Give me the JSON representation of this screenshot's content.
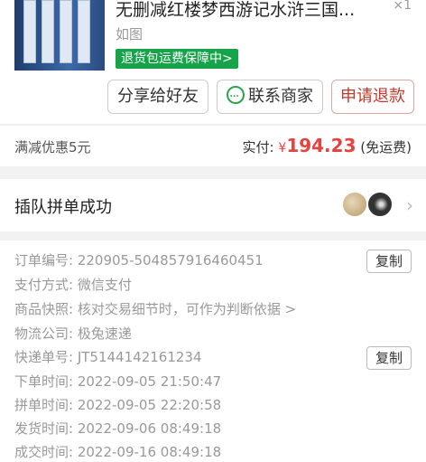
{
  "product": {
    "title": "无删减红楼梦西游记水浒三国...",
    "quantity": "×1",
    "spec": "如图",
    "guarantee": "退货包运费保障中>"
  },
  "actions": {
    "share": "分享给好友",
    "contact": "联系商家",
    "refund": "申请退款"
  },
  "payment": {
    "discount": "满减优惠5元",
    "paid_label": "实付:",
    "currency": "¥",
    "amount": "194.23",
    "shipping_note": "(免运费)"
  },
  "group": {
    "status": "插队拼单成功"
  },
  "order": {
    "order_no_label": "订单编号:",
    "order_no": "220905-504857916460451",
    "copy": "复制",
    "pay_method_label": "支付方式:",
    "pay_method": "微信支付",
    "snapshot_label": "商品快照:",
    "snapshot": "核对交易细节时，可作为判断依据 >",
    "logistics_label": "物流公司:",
    "logistics": "极兔速递",
    "tracking_label": "快递单号:",
    "tracking": "JT5144142161234",
    "order_time_label": "下单时间:",
    "order_time": "2022-09-05 21:50:47",
    "group_time_label": "拼单时间:",
    "group_time": "2022-09-05 22:20:58",
    "ship_time_label": "发货时间:",
    "ship_time": "2022-09-06 08:49:18",
    "deal_time_label": "成交时间:",
    "deal_time": "2022-09-16 08:49:18"
  }
}
